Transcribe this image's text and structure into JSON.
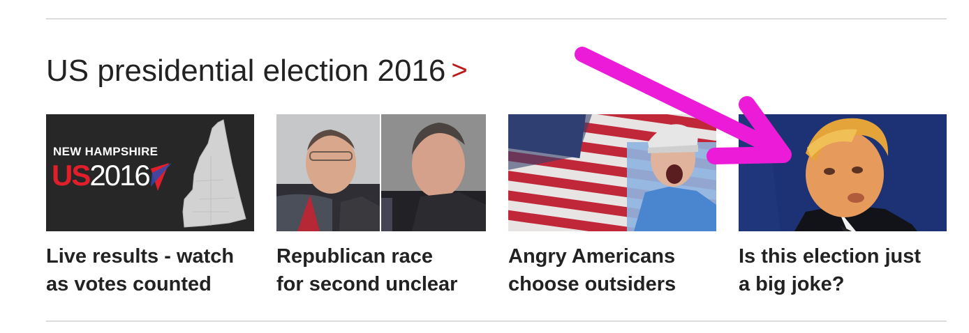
{
  "section": {
    "title": "US presidential election 2016",
    "chevron": ">"
  },
  "cards": [
    {
      "headline": "Live results - watch as votes counted",
      "headline_line1": "Live results - watch",
      "headline_line2": "as votes counted",
      "thumb_label": "NEW HAMPSHIRE",
      "thumb_logo_us": "US",
      "thumb_logo_year": "2016"
    },
    {
      "headline": "Republican race for second unclear",
      "headline_line1": "Republican race",
      "headline_line2": "for second unclear"
    },
    {
      "headline": "Angry Americans choose outsiders",
      "headline_line1": "Angry Americans",
      "headline_line2": "choose outsiders"
    },
    {
      "headline": "Is this election just a big joke?",
      "headline_line1": "Is this election just",
      "headline_line2": "a big joke?"
    }
  ],
  "colors": {
    "accent_chevron": "#bb1919",
    "annotation_arrow": "#ec1bd8",
    "text": "#222222",
    "rule": "#dcdcdc"
  },
  "icons": {
    "chevron": "chevron-right-icon",
    "annotation": "arrow-annotation-icon"
  }
}
